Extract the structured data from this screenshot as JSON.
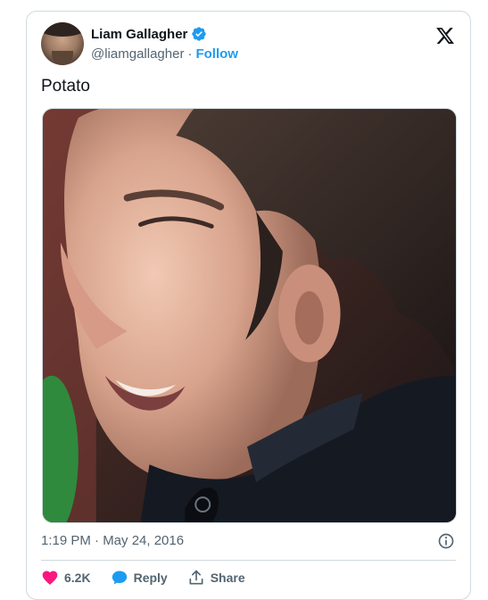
{
  "author": {
    "name": "Liam Gallagher",
    "handle": "@liamgallagher",
    "separator": "·",
    "follow_label": "Follow"
  },
  "icons": {
    "verified": "verified-badge-icon",
    "brand": "x-logo-icon",
    "info": "info-icon",
    "like": "heart-icon",
    "reply": "reply-bubble-icon",
    "share": "share-icon"
  },
  "colors": {
    "accent": "#1d9bf0",
    "like": "#f91880",
    "secondary_text": "#536471"
  },
  "tweet": {
    "text": "Potato",
    "timestamp": "1:19 PM · May 24, 2016"
  },
  "actions": {
    "likes_count": "6.2K",
    "reply_label": "Reply",
    "share_label": "Share"
  }
}
